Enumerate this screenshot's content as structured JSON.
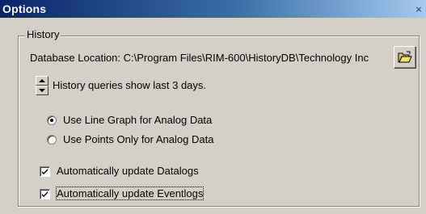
{
  "window": {
    "title": "Options",
    "close_glyph": "×"
  },
  "history": {
    "group_label": "History",
    "database_location_text": "Database Location: C:\\Program Files\\RIM-600\\HistoryDB\\Technology Inc",
    "browse_icon": "folder-open-icon",
    "days_text": "History queries show last 3 days.",
    "days_value": 3,
    "radio_options": [
      {
        "label": "Use Line Graph for Analog Data",
        "selected": true
      },
      {
        "label": "Use Points Only for Analog Data",
        "selected": false
      }
    ],
    "checkboxes": [
      {
        "label": "Automatically update Datalogs",
        "checked": true
      },
      {
        "label": "Automatically update Eventlogs",
        "checked": true
      }
    ]
  }
}
